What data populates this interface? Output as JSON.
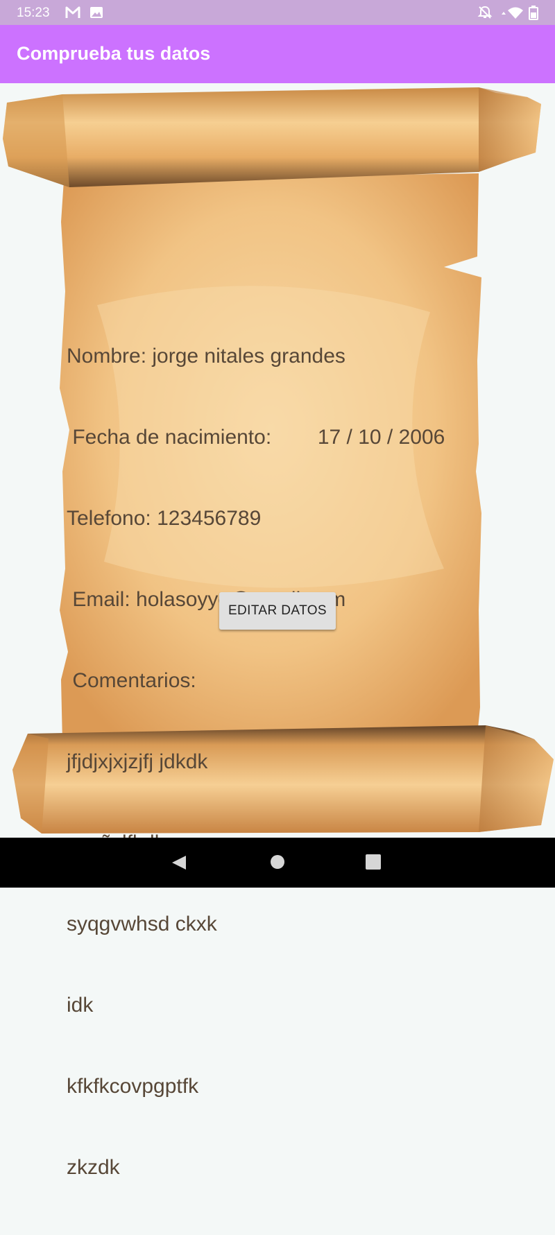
{
  "status_bar": {
    "time": "15:23",
    "left_icons": [
      "gmail-icon",
      "image-icon"
    ],
    "right_icons": [
      "notifications-off-icon",
      "wifi-icon",
      "battery-icon"
    ]
  },
  "app_bar": {
    "title": "Comprueba tus datos"
  },
  "form_summary": {
    "nombre": "Nombre: jorge nitales grandes",
    "fecha": " Fecha de nacimiento:        17 / 10 / 2006",
    "telefono": "Telefono: 123456789",
    "email": " Email: holasoyyo@gmail.com",
    "comentarios_label": " Comentarios:",
    "comentarios_lines": [
      "jfjdjxjxjzjfj jdkdk",
      "vpgñvlfkdk",
      "syqgvwhsd ckxk",
      "idk",
      "kfkfkcovpgptfk",
      "zkzdk"
    ]
  },
  "actions": {
    "edit_button": "EDITAR DATOS"
  },
  "nav_bar": {
    "icons": [
      "back-icon",
      "home-icon",
      "recents-icon"
    ]
  },
  "colors": {
    "status_bar": "#c8a8d8",
    "app_bar": "#cc72ff",
    "background": "#f4f8f7",
    "parchment": "#f2c88f",
    "text": "#574737"
  }
}
